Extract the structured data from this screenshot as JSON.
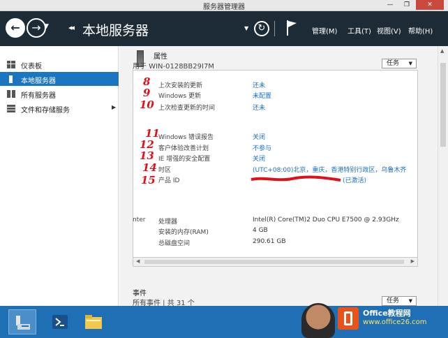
{
  "window": {
    "title": "服务器管理器",
    "min": "—",
    "max": "❐",
    "close": "✕"
  },
  "header": {
    "page_title": "本地服务器",
    "breadcrumb_arrows": "◂◂",
    "menu": [
      "管理(M)",
      "工具(T)",
      "视图(V)",
      "帮助(H)"
    ]
  },
  "sidebar": {
    "items": [
      {
        "label": "仪表板",
        "icon": "dashboard-icon",
        "active": false
      },
      {
        "label": "本地服务器",
        "icon": "server-icon",
        "active": true
      },
      {
        "label": "所有服务器",
        "icon": "servers-icon",
        "active": false
      },
      {
        "label": "文件和存储服务",
        "icon": "storage-icon",
        "active": false,
        "expand": "▶"
      }
    ]
  },
  "properties": {
    "title": "属性",
    "subtitle": "用于 WIN-0128BB29I7M",
    "tasks_label": "任务",
    "rows": [
      {
        "label": "上次安装的更新",
        "value": "还未"
      },
      {
        "label": "Windows 更新",
        "value": "未配置"
      },
      {
        "label": "上次检查更新的时间",
        "value": "还未"
      },
      {
        "label": "Windows 错误报告",
        "value": "关闭"
      },
      {
        "label": "客户体验改善计划",
        "value": "不参与"
      },
      {
        "label": "IE 增强的安全配置",
        "value": "关闭"
      },
      {
        "label": "时区",
        "value": "(UTC+08:00)北京，重庆，香港特别行政区，乌鲁木齐"
      },
      {
        "label": "产品 ID",
        "value": "(已激活)"
      }
    ],
    "hardware_prefix": "nter",
    "hardware": [
      {
        "label": "处理器",
        "value": "Intel(R) Core(TM)2 Duo CPU     E7500  @ 2.93GHz"
      },
      {
        "label": "安装的内存(RAM)",
        "value": "4 GB"
      },
      {
        "label": "总磁盘空间",
        "value": "290.61 GB"
      }
    ]
  },
  "annotations": [
    "8",
    "9",
    "10",
    "11",
    "12",
    "13",
    "14",
    "15"
  ],
  "events": {
    "title": "事件",
    "subtitle": "所有事件 | 共 31 个",
    "tasks_label": "任务"
  },
  "watermark": {
    "line1": "Office教程网",
    "line2": "www.office26.com"
  },
  "colors": {
    "header": "#1d2b37",
    "accent": "#1b76c2",
    "link": "#1a6ec7",
    "taskbar": "#1f6fb4",
    "annotation": "#e01018"
  }
}
